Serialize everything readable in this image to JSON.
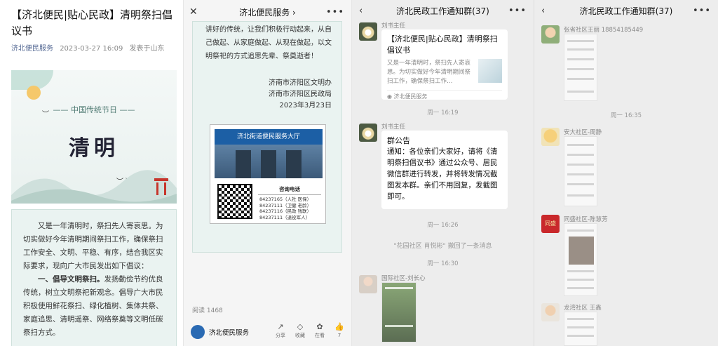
{
  "article": {
    "title": "【济北便民|贴心民政】清明祭扫倡议书",
    "account": "济北便民服务",
    "time": "2023-03-27 16:09",
    "location": "发表于山东",
    "banner_sub": "中国传统节日",
    "banner_main": "清明",
    "paragraphs": [
      "又是一年清明时，祭扫先人寄哀思。为切实做好今年清明期间祭扫工作，确保祭扫工作安全、文明、平稳、有序，结合我区实际要求，现向广大市民发出如下倡议：",
      "一、倡导文明祭扫。",
      "发扬勤俭节约优良传统，树立文明祭祀新观念。倡导广大市民积极使用鲜花祭扫、绿化植树、集体共祭、家庭追思、清明遥祭、网络祭奠等文明低碳祭扫方式。"
    ]
  },
  "article2": {
    "nav_title": "济北便民服务 ›",
    "text_top": "讲好的传统，让我们积极行动起来，从自己做起、从家庭做起、从现在做起，以文明祭祀的方式追思先辈、祭奠逝者！",
    "sig": [
      "济南市济阳区文明办",
      "济南市济阳区民政局",
      "2023年3月23日"
    ],
    "sign_board": "济北街道便民服务大厅",
    "phone_title": "咨询电话",
    "phones": [
      "84237165（人社 医保）",
      "84237111（卫健 老龄）",
      "84237116（民政 残联）",
      "84237111（退役军人）"
    ],
    "reads": "阅读 1468",
    "account": "济北便民服务",
    "actions": [
      {
        "icon": "↗",
        "label": "分享"
      },
      {
        "icon": "◇",
        "label": "收藏"
      },
      {
        "icon": "✿",
        "label": "在看"
      },
      {
        "icon": "👍",
        "label": "7"
      }
    ]
  },
  "chat1": {
    "title": "济北民政工作通知群(37)",
    "msg1": {
      "nick": "刘书主任",
      "card_title": "【济北便民|贴心民政】清明祭扫倡议书",
      "card_desc": "又是一年清明时，祭扫先人寄哀思。为切实做好今年清明期间祭扫工作，确保祭扫工作…",
      "card_src": "济北便民服务"
    },
    "time1": "周一 16:19",
    "msg2": {
      "nick": "刘书主任",
      "title": "群公告",
      "body": "通知：各位亲们大家好，请将《清明祭扫倡议书》通过公众号、居民微信群进行转发，并将转发情况截图发本群。亲们不用回复，发截图即可。"
    },
    "time2": "周一 16:26",
    "recall": "\"花园社区 肖悦彬\" 撤回了一条消息",
    "time3": "周一 16:30",
    "msg3": {
      "nick": "国际社区-刘长心"
    }
  },
  "chat2": {
    "title": "济北民政工作通知群(37)",
    "msg1": {
      "nick": "张省社区王丽 18854185449"
    },
    "time1": "周一 16:35",
    "msg2": {
      "nick": "安大社区-周静"
    },
    "msg3": {
      "nick": "同盛社区-陈慧芳"
    },
    "msg4": {
      "nick": "龙湾社区 王鑫"
    },
    "avatar_red_text": "同盛"
  }
}
